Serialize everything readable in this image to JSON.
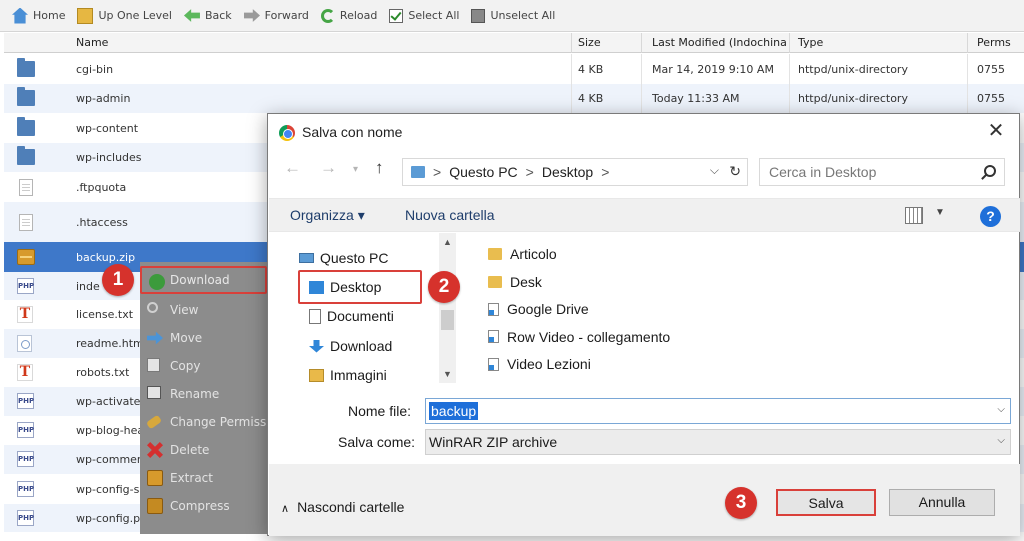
{
  "toolbar": {
    "home": "Home",
    "up_one_level": "Up One Level",
    "back": "Back",
    "forward": "Forward",
    "reload": "Reload",
    "select_all": "Select All",
    "unselect_all": "Unselect All"
  },
  "table": {
    "headers": {
      "name": "Name",
      "size": "Size",
      "last_modified": "Last Modified (Indochina",
      "type": "Type",
      "perms": "Perms"
    },
    "rows": [
      {
        "name": "cgi-bin",
        "size": "4 KB",
        "modified": "Mar 14, 2019 9:10 AM",
        "type": "httpd/unix-directory",
        "perms": "0755",
        "icon": "folder"
      },
      {
        "name": "wp-admin",
        "size": "4 KB",
        "modified": "Today 11:33 AM",
        "type": "httpd/unix-directory",
        "perms": "0755",
        "icon": "folder"
      },
      {
        "name": "wp-content",
        "size": "",
        "modified": "",
        "type": "",
        "perms": "",
        "icon": "folder"
      },
      {
        "name": "wp-includes",
        "size": "",
        "modified": "",
        "type": "",
        "perms": "",
        "icon": "folder"
      },
      {
        "name": ".ftpquota",
        "size": "",
        "modified": "",
        "type": "",
        "perms": "",
        "icon": "file"
      },
      {
        "name": ".htaccess",
        "size": "",
        "modified": "",
        "type": "",
        "perms": "",
        "icon": "file"
      },
      {
        "name": "backup.zip",
        "size": "",
        "modified": "",
        "type": "",
        "perms": "",
        "icon": "zip"
      },
      {
        "name": "inde",
        "size": "",
        "modified": "",
        "type": "",
        "perms": "",
        "icon": "php"
      },
      {
        "name": "license.txt",
        "size": "",
        "modified": "",
        "type": "",
        "perms": "",
        "icon": "txt"
      },
      {
        "name": "readme.htm",
        "size": "",
        "modified": "",
        "type": "",
        "perms": "",
        "icon": "html"
      },
      {
        "name": "robots.txt",
        "size": "",
        "modified": "",
        "type": "",
        "perms": "",
        "icon": "txt"
      },
      {
        "name": "wp-activate.",
        "size": "",
        "modified": "",
        "type": "",
        "perms": "",
        "icon": "php"
      },
      {
        "name": "wp-blog-hea",
        "size": "",
        "modified": "",
        "type": "",
        "perms": "",
        "icon": "php"
      },
      {
        "name": "wp-commen",
        "size": "",
        "modified": "",
        "type": "",
        "perms": "",
        "icon": "php"
      },
      {
        "name": "wp-config-sa",
        "size": "",
        "modified": "",
        "type": "",
        "perms": "",
        "icon": "php"
      },
      {
        "name": "wp-config.pl",
        "size": "",
        "modified": "",
        "type": "",
        "perms": "",
        "icon": "php"
      }
    ],
    "php_icon_text": "PHP",
    "txt_icon_text": "T"
  },
  "context_menu": {
    "items": [
      "Download",
      "View",
      "Move",
      "Copy",
      "Rename",
      "Change Permiss",
      "Delete",
      "Extract",
      "Compress"
    ]
  },
  "badges": [
    "1",
    "2",
    "3"
  ],
  "dialog": {
    "title": "Salva con nome",
    "close": "✕",
    "address": {
      "pc": "Questo PC",
      "folder": "Desktop",
      "sep": ">"
    },
    "search_placeholder": "Cerca in Desktop",
    "organize": "Organizza ▾",
    "new_folder": "Nuova cartella",
    "help": "?",
    "nav_items": [
      "Questo PC",
      "Desktop",
      "Documenti",
      "Download",
      "Immagini"
    ],
    "list_items": [
      {
        "name": "Articolo",
        "kind": "folder"
      },
      {
        "name": "Desk",
        "kind": "folder"
      },
      {
        "name": "Google Drive",
        "kind": "shortcut"
      },
      {
        "name": "Row Video - collegamento",
        "kind": "shortcut"
      },
      {
        "name": "Video Lezioni",
        "kind": "shortcut"
      }
    ],
    "file_name_label": "Nome file:",
    "file_name_value": "backup",
    "save_as_label": "Salva come:",
    "save_as_value": "WinRAR ZIP archive",
    "hide_folders": "Nascondi cartelle",
    "save_button": "Salva",
    "cancel_button": "Annulla"
  },
  "colors": {
    "selected_row": "#3e78c9",
    "highlight_box": "#d9403a",
    "badge": "#d6322c",
    "context_menu_bg": "#8c8c8c"
  }
}
